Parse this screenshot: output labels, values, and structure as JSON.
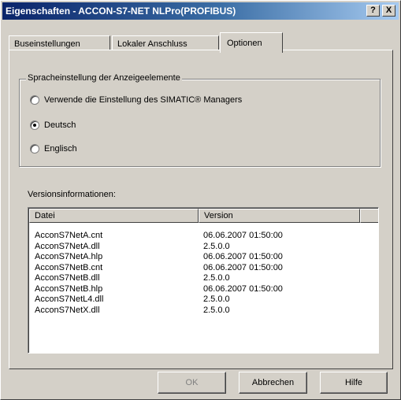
{
  "window": {
    "title": "Eigenschaften - ACCON-S7-NET NLPro(PROFIBUS)",
    "help_label": "?",
    "close_label": "X"
  },
  "tabs": [
    {
      "label": "Buseinstellungen",
      "active": false
    },
    {
      "label": "Lokaler Anschluss",
      "active": false
    },
    {
      "label": "Optionen",
      "active": true
    }
  ],
  "language_group": {
    "legend": "Spracheinstellung der Anzeigeelemente",
    "options": [
      {
        "label": "Verwende die Einstellung des SIMATIC® Managers",
        "checked": false
      },
      {
        "label": "Deutsch",
        "checked": true
      },
      {
        "label": "Englisch",
        "checked": false
      }
    ]
  },
  "version_info": {
    "label": "Versionsinformationen:",
    "columns": [
      "Datei",
      "Version"
    ],
    "rows": [
      {
        "file": "AcconS7NetA.cnt",
        "version": "06.06.2007  01:50:00"
      },
      {
        "file": "AcconS7NetA.dll",
        "version": "2.5.0.0"
      },
      {
        "file": "AcconS7NetA.hlp",
        "version": "06.06.2007  01:50:00"
      },
      {
        "file": "AcconS7NetB.cnt",
        "version": "06.06.2007  01:50:00"
      },
      {
        "file": "AcconS7NetB.dll",
        "version": "2.5.0.0"
      },
      {
        "file": "AcconS7NetB.hlp",
        "version": "06.06.2007  01:50:00"
      },
      {
        "file": "AcconS7NetL4.dll",
        "version": "2.5.0.0"
      },
      {
        "file": "AcconS7NetX.dll",
        "version": "2.5.0.0"
      }
    ]
  },
  "buttons": {
    "ok": "OK",
    "cancel": "Abbrechen",
    "help": "Hilfe"
  }
}
